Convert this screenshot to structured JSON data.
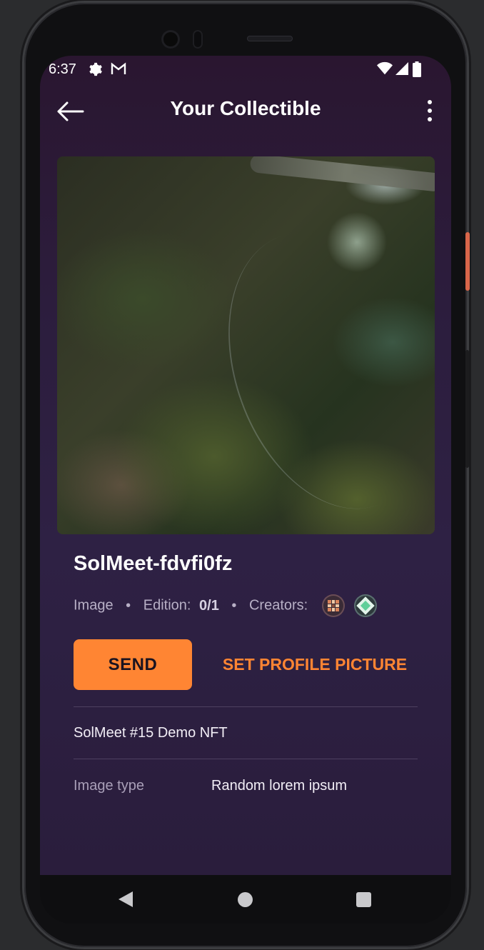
{
  "status_bar": {
    "time": "6:37",
    "icons": [
      "settings-icon",
      "gmail-icon",
      "wifi-icon",
      "signal-icon",
      "battery-icon"
    ]
  },
  "app_bar": {
    "title": "Your Collectible",
    "back_icon": "arrow-left-icon",
    "menu_icon": "more-vertical-icon"
  },
  "collectible": {
    "name": "SolMeet-fdvfi0fz",
    "media_type": "Image",
    "edition_label": "Edition:",
    "edition_value": "0/1",
    "creators_label": "Creators:",
    "separator": "•",
    "creators": [
      "creator-avatar-1",
      "creator-avatar-2"
    ],
    "description": "SolMeet #15 Demo NFT",
    "attributes": [
      {
        "key": "Image type",
        "value": "Random lorem ipsum"
      }
    ]
  },
  "actions": {
    "send_label": "SEND",
    "set_profile_label": "SET PROFILE PICTURE"
  },
  "nav_bar": {
    "icons": [
      "nav-back-icon",
      "nav-home-icon",
      "nav-recents-icon"
    ]
  },
  "colors": {
    "accent": "#ff8533",
    "background_top": "#2a1630",
    "background_bottom": "#2a1d3c",
    "text_primary": "#ffffff",
    "text_secondary": "#b8b0c6"
  }
}
